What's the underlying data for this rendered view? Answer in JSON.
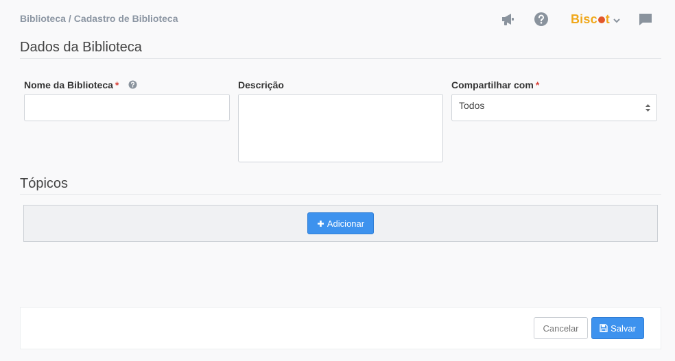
{
  "breadcrumb": {
    "items": [
      "Biblioteca",
      "Cadastro de Biblioteca"
    ],
    "separator": "/"
  },
  "header": {
    "icons": [
      "megaphone-icon",
      "help-icon",
      "chat-icon"
    ],
    "logo": {
      "text_before": "Bisc",
      "text_after": "t",
      "dot_color": "#e2572b",
      "color": "#f0a81b"
    }
  },
  "sections": {
    "library_data": "Dados da Biblioteca",
    "topics": "Tópicos"
  },
  "form": {
    "name": {
      "label": "Nome da Biblioteca",
      "required_mark": "*",
      "value": "",
      "placeholder": ""
    },
    "description": {
      "label": "Descrição",
      "value": "",
      "placeholder": ""
    },
    "share_with": {
      "label": "Compartilhar com",
      "required_mark": "*",
      "selected": "Todos"
    }
  },
  "topics": {
    "add_label": "Adicionar"
  },
  "footer": {
    "cancel_label": "Cancelar",
    "save_label": "Salvar"
  },
  "colors": {
    "primary": "#3d92ee",
    "required": "#d9443c",
    "logo": "#f0a81b"
  }
}
